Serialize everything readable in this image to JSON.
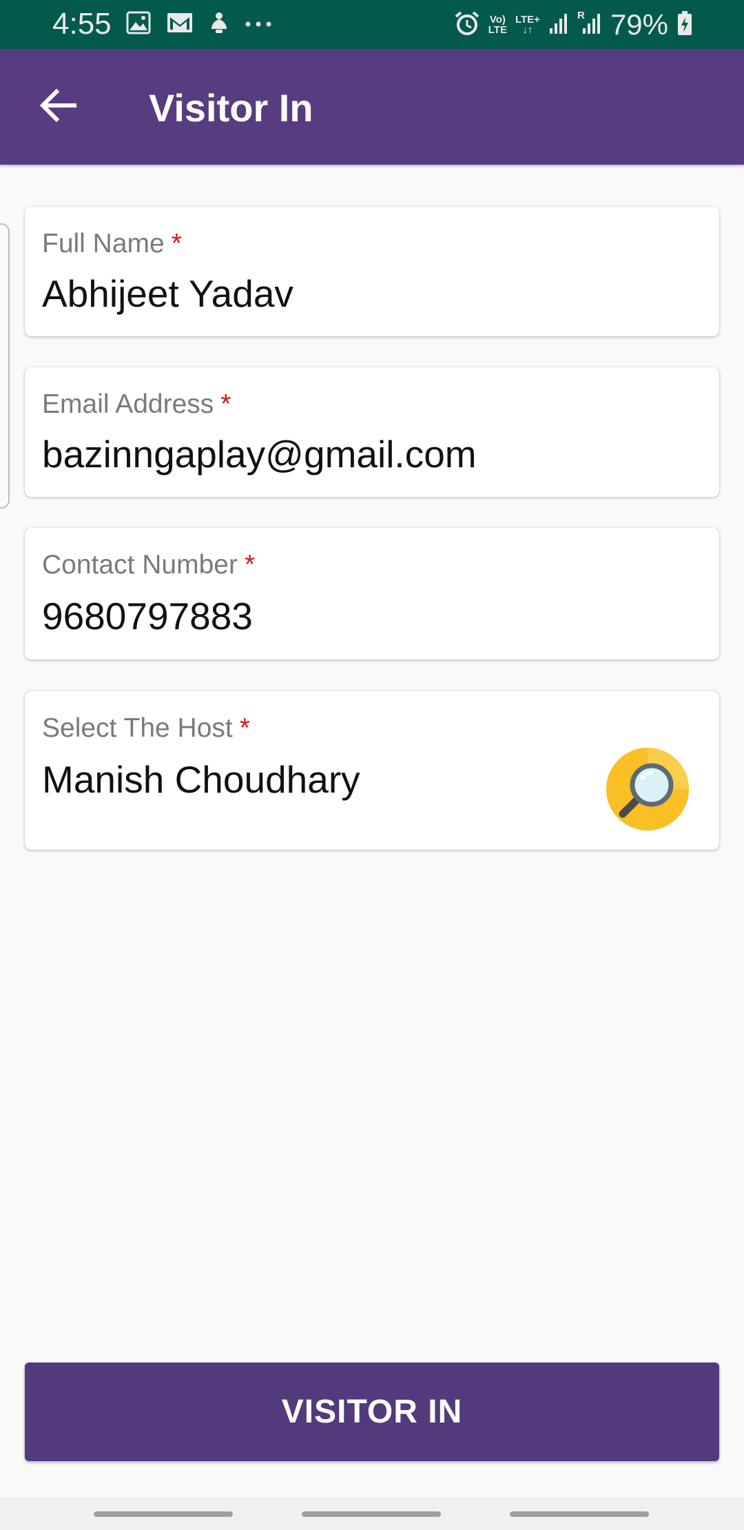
{
  "status_bar": {
    "time": "4:55",
    "battery_percent": "79%",
    "volte_top": "Vo)",
    "volte_bottom": "LTE",
    "lte_label": "LTE+",
    "roaming_label": "R",
    "icons_left": [
      "image-icon",
      "gmail-icon",
      "notification-icon",
      "more-dots-icon"
    ],
    "icons_right": [
      "alarm-icon",
      "volte-icon",
      "lte-icon",
      "signal-icon",
      "signal-roaming-icon",
      "battery-icon"
    ]
  },
  "app_bar": {
    "title": "Visitor In",
    "back_icon": "back-arrow-icon",
    "color": "#583c80"
  },
  "form": {
    "full_name": {
      "label": "Full Name",
      "required_mark": "*",
      "value": "Abhijeet Yadav"
    },
    "email": {
      "label": "Email Address",
      "required_mark": "*",
      "value": "bazinngaplay@gmail.com"
    },
    "contact": {
      "label": "Contact Number",
      "required_mark": "*",
      "value": "9680797883"
    },
    "host": {
      "label": "Select The Host",
      "required_mark": "*",
      "value": "Manish Choudhary",
      "search_icon": "magnifier-search-icon"
    }
  },
  "actions": {
    "submit_label": "VISITOR IN",
    "submit_color": "#533a7c"
  },
  "colors": {
    "status_bar": "#035a4c",
    "required": "#d51717",
    "background": "#f9f9f9"
  }
}
